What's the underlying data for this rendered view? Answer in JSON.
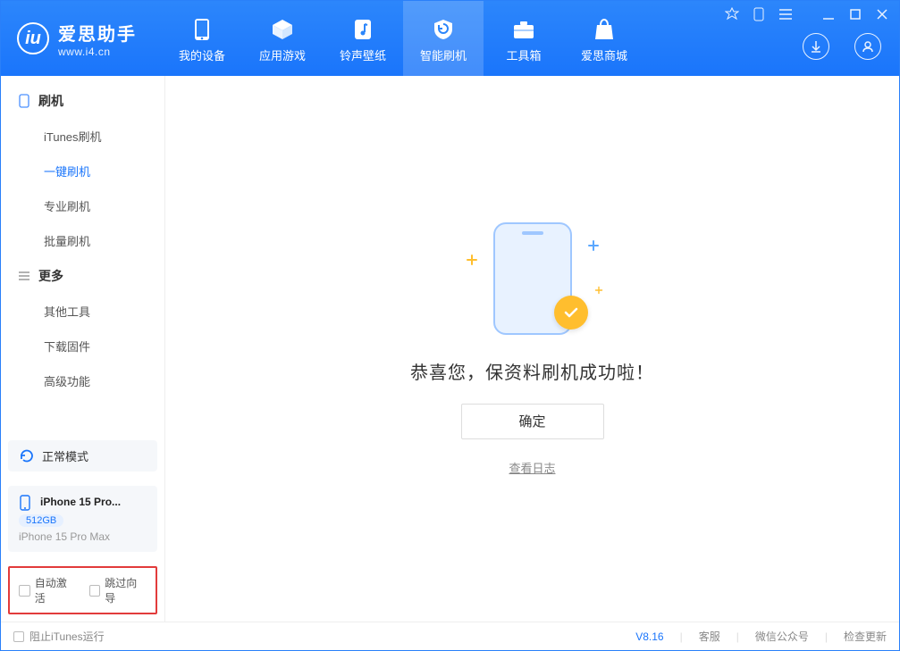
{
  "app": {
    "name": "爱思助手",
    "url": "www.i4.cn"
  },
  "nav": {
    "items": [
      {
        "label": "我的设备"
      },
      {
        "label": "应用游戏"
      },
      {
        "label": "铃声壁纸"
      },
      {
        "label": "智能刷机",
        "active": true
      },
      {
        "label": "工具箱"
      },
      {
        "label": "爱思商城"
      }
    ]
  },
  "sidebar": {
    "groups": [
      {
        "title": "刷机",
        "items": [
          "iTunes刷机",
          "一键刷机",
          "专业刷机",
          "批量刷机"
        ],
        "active_index": 1
      },
      {
        "title": "更多",
        "items": [
          "其他工具",
          "下载固件",
          "高级功能"
        ],
        "active_index": -1
      }
    ],
    "mode_label": "正常模式",
    "device": {
      "name_short": "iPhone 15 Pro...",
      "capacity": "512GB",
      "model": "iPhone 15 Pro Max"
    },
    "checkboxes": {
      "auto_activate": "自动激活",
      "skip_guide": "跳过向导"
    }
  },
  "main": {
    "success_text": "恭喜您，保资料刷机成功啦！",
    "ok_button": "确定",
    "view_log": "查看日志"
  },
  "footer": {
    "block_itunes": "阻止iTunes运行",
    "version": "V8.16",
    "links": [
      "客服",
      "微信公众号",
      "检查更新"
    ]
  }
}
